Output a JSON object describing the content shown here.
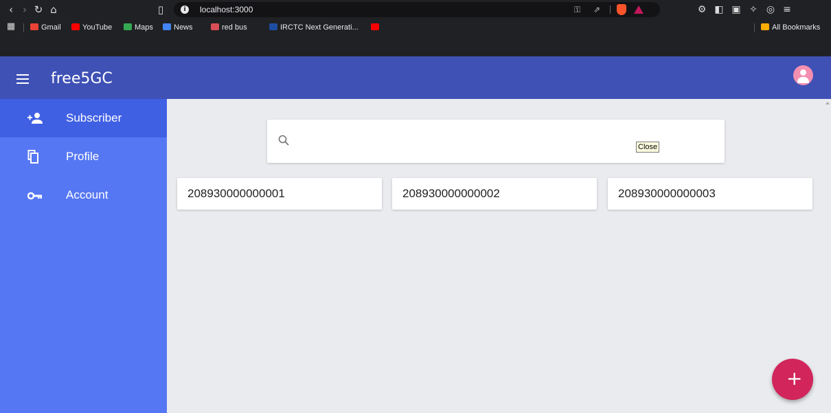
{
  "browser": {
    "url": "localhost:3000",
    "bookmarks": [
      {
        "label": "Gmail",
        "color": "#ea4335"
      },
      {
        "label": "YouTube",
        "color": "#ff0000"
      },
      {
        "label": "Maps",
        "color": "#34a853"
      },
      {
        "label": "News",
        "color": "#4285f4"
      },
      {
        "label": "red bus",
        "color": "#d84e55"
      },
      {
        "label": "IRCTC Next Generati...",
        "color": "#1c4da1"
      }
    ],
    "all_bookmarks_label": "All Bookmarks"
  },
  "app": {
    "title": "free5GC",
    "header_color": "#3f51b5",
    "sidebar_color": "#5677f3",
    "avatar_color": "#f48fb1",
    "fab_color": "#d1255b"
  },
  "sidebar": {
    "items": [
      {
        "label": "Subscriber",
        "icon": "person-add-icon",
        "active": true
      },
      {
        "label": "Profile",
        "icon": "copy-icon",
        "active": false
      },
      {
        "label": "Account",
        "icon": "key-icon",
        "active": false
      }
    ]
  },
  "search": {
    "placeholder": "",
    "value": "",
    "tooltip": "Close"
  },
  "subscribers": [
    {
      "id": "208930000000001"
    },
    {
      "id": "208930000000002"
    },
    {
      "id": "208930000000003"
    }
  ],
  "fab": {
    "label": "+"
  }
}
